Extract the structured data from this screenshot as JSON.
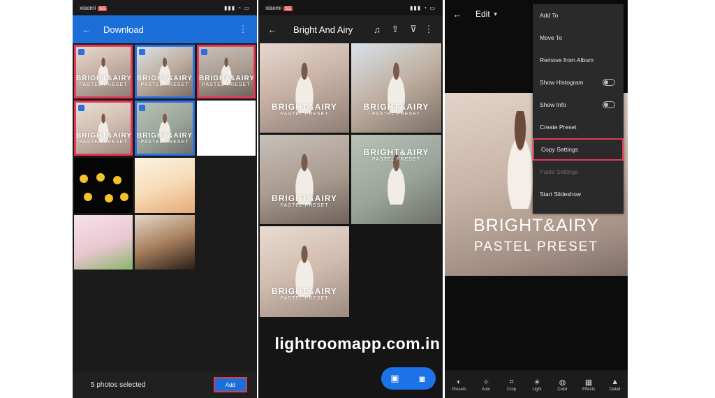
{
  "panel1": {
    "title": "Download",
    "selected_text": "5 photos selected",
    "add_label": "Add",
    "tiles": [
      {
        "caption": "BRIGHT&AIRY",
        "sub": "PASTEL PRESET"
      },
      {
        "caption": "BRIGHT&AIRY",
        "sub": "PASTEL PRESET"
      },
      {
        "caption": "BRIGHT&AIRY",
        "sub": "PASTEL PRESET"
      },
      {
        "caption": "BRIGHT&AIRY",
        "sub": "PASTEL PRESET"
      },
      {
        "caption": "BRIGHT&AIRY",
        "sub": "PASTEL PRESET"
      }
    ]
  },
  "panel2": {
    "title": "Bright And Airy",
    "tiles": [
      {
        "caption": "BRIGHT&AIRY",
        "sub": "PASTEL PRESET"
      },
      {
        "caption": "BRIGHT&AIRY",
        "sub": "PASTEL PRESET"
      },
      {
        "caption": "BRIGHT&AIRY",
        "sub": "PASTEL PRESET"
      },
      {
        "caption": "BRIGHT&AIRY",
        "sub": "PASTEL PRESET"
      },
      {
        "caption": "BRIGHT&AIRY",
        "sub": "PASTEL PRESET"
      }
    ]
  },
  "panel3": {
    "edit_label": "Edit",
    "menu": [
      {
        "label": "Add To",
        "state": "normal"
      },
      {
        "label": "Move To",
        "state": "normal"
      },
      {
        "label": "Remove from Album",
        "state": "normal"
      },
      {
        "label": "Show Histogram",
        "state": "toggle"
      },
      {
        "label": "Show Info",
        "state": "toggle"
      },
      {
        "label": "Create Preset",
        "state": "normal"
      },
      {
        "label": "Copy Settings",
        "state": "highlight"
      },
      {
        "label": "Paste Settings",
        "state": "dim"
      },
      {
        "label": "Start Slideshow",
        "state": "normal"
      }
    ],
    "photo_caption": "BRIGHT&AIRY",
    "photo_subcaption": "PASTEL PRESET",
    "tools": [
      "Presets",
      "Auto",
      "Crop",
      "Light",
      "Color",
      "Effects",
      "Detail"
    ]
  },
  "watermark": "lightroomapp.com.in",
  "colors": {
    "accent": "#1c6fd8",
    "highlight": "#e23a55"
  }
}
